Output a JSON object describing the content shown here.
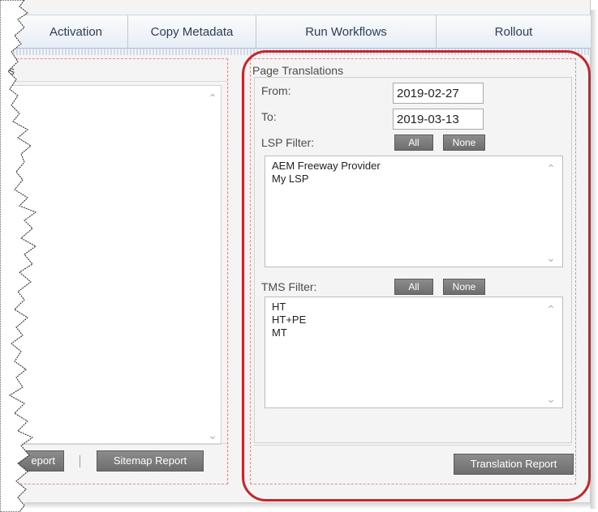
{
  "tabs": [
    {
      "label": "Activation"
    },
    {
      "label": "Copy Metadata"
    },
    {
      "label": "Run Workflows"
    },
    {
      "label": "Rollout"
    }
  ],
  "left_panel": {
    "title": "s",
    "buttons": {
      "report_partial": "eport",
      "sitemap_report": "Sitemap Report"
    }
  },
  "page_translations": {
    "title": "Page Translations",
    "from_label": "From:",
    "from_value": "2019-02-27",
    "to_label": "To:",
    "to_value": "2019-03-13",
    "lsp_filter": {
      "label": "LSP Filter:",
      "all_label": "All",
      "none_label": "None",
      "items": [
        "AEM Freeway Provider",
        "My LSP"
      ]
    },
    "tms_filter": {
      "label": "TMS Filter:",
      "all_label": "All",
      "none_label": "None",
      "items": [
        "HT",
        "HT+PE",
        "MT"
      ]
    },
    "translation_report_label": "Translation Report"
  },
  "icons": {
    "scroll_up": "chevron-up-icon",
    "scroll_down": "chevron-down-icon"
  },
  "colors": {
    "highlight": "#c1272d",
    "panel_dash": "#e58b8b",
    "button": "#7d7d7d"
  }
}
